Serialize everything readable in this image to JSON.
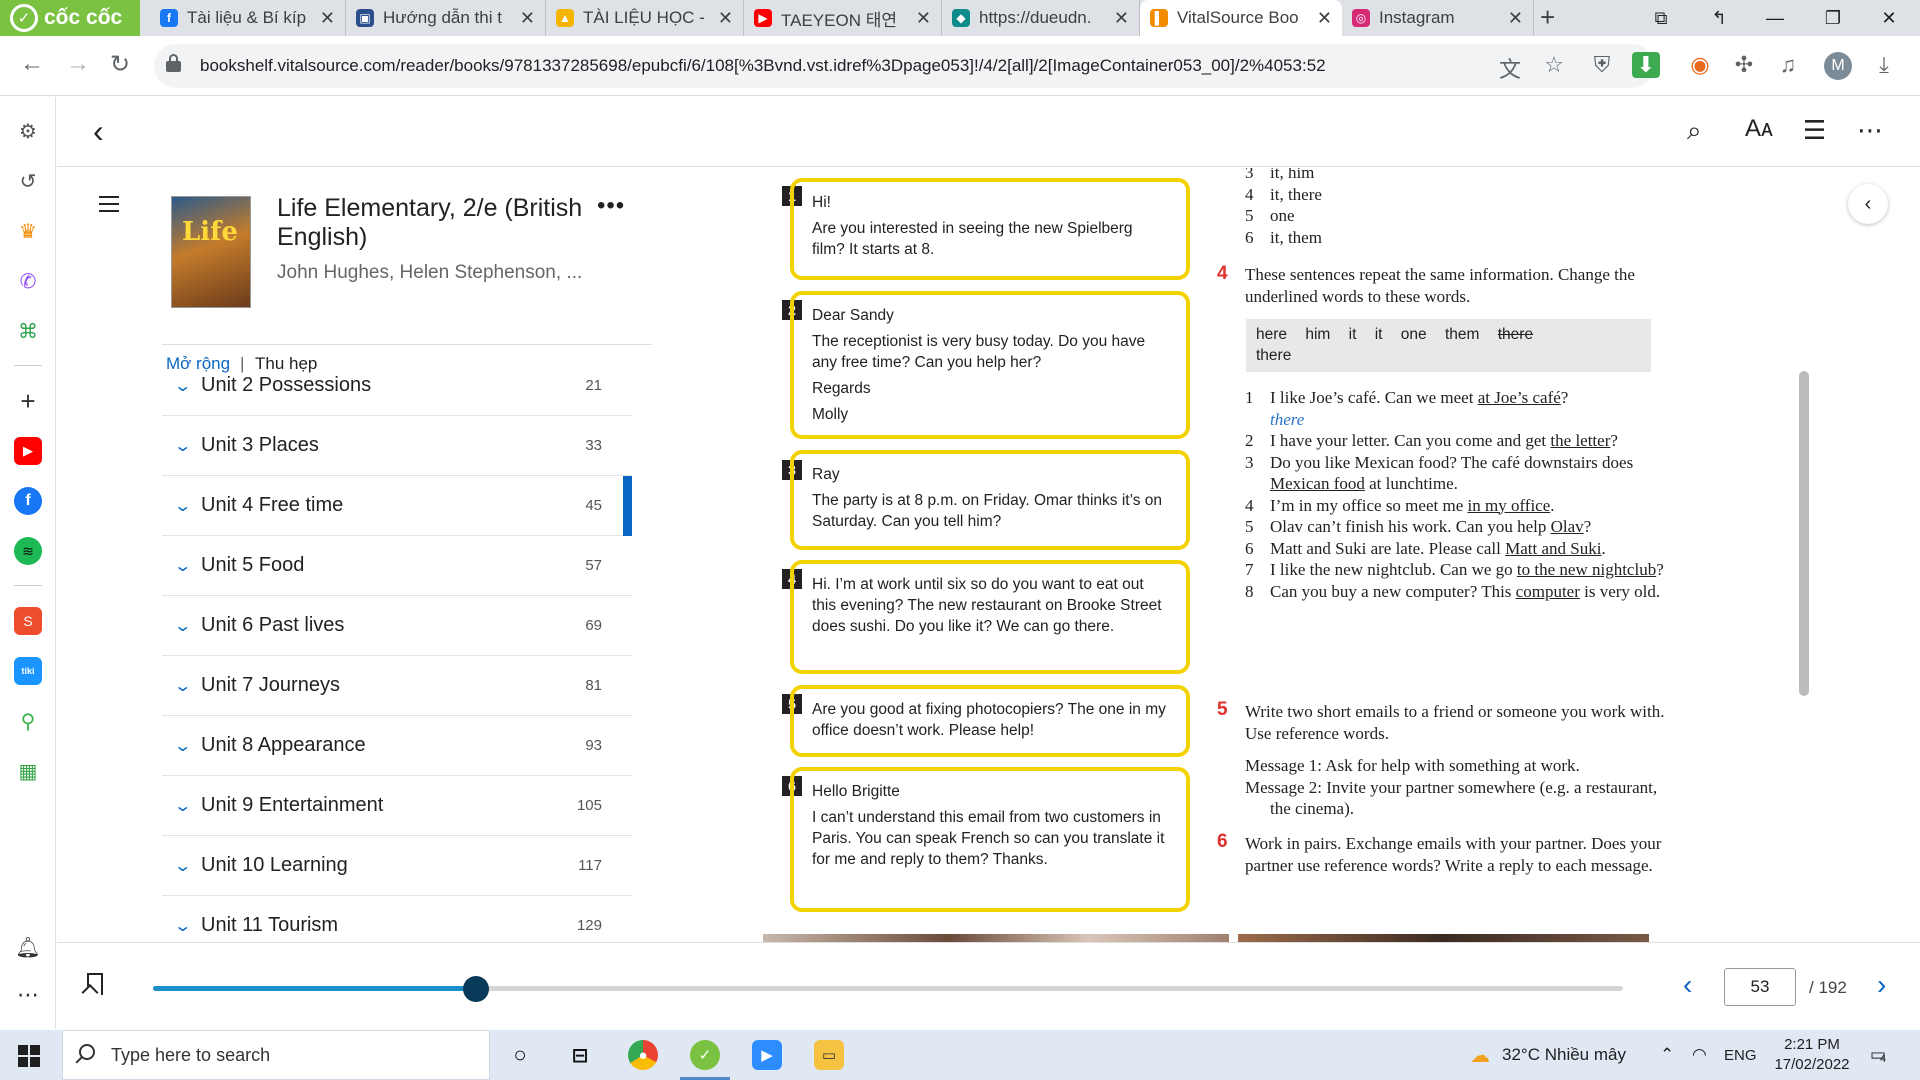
{
  "browser": {
    "brand": "cốc cốc",
    "tabs": [
      {
        "title": "Tài liệu & Bí kíp",
        "icon": "facebook-icon",
        "color": "#1877f2",
        "glyph": "f"
      },
      {
        "title": "Hướng dẫn thi t",
        "icon": "document-icon",
        "color": "#2b4f8c",
        "glyph": "▣"
      },
      {
        "title": "TÀI LIỆU HỌC -",
        "icon": "google-drive-icon",
        "color": "#f4b400",
        "glyph": "▲"
      },
      {
        "title": "TAEYEON 태연",
        "icon": "youtube-icon",
        "color": "#ff0000",
        "glyph": "▶"
      },
      {
        "title": "https://dueudn.",
        "icon": "chatbot-icon",
        "color": "#0e8c8c",
        "glyph": "◆"
      },
      {
        "title": "VitalSource Boo",
        "icon": "vitalsource-icon",
        "color": "#f28b00",
        "glyph": "▌"
      },
      {
        "title": "Instagram",
        "icon": "instagram-icon",
        "color": "#d62976",
        "glyph": "◎"
      }
    ],
    "active_tab": 5,
    "url": "bookshelf.vitalsource.com/reader/books/9781337285698/epubcfi/6/108[%3Bvnd.vst.idref%3Dpage053]!/4/2[all]/2[ImageContainer053_00]/2%4053:52",
    "profile_initial": "M"
  },
  "book": {
    "title": "Life Elementary, 2/e (British English)",
    "authors": "John Hughes, Helen Stephenson, ...",
    "cover_text": "Life"
  },
  "toc": {
    "expand_label": "Mở rộng",
    "separator": "|",
    "collapse_label": "Thu hẹp",
    "chevron": "⌄",
    "units": [
      {
        "label": "Unit 2 Possessions",
        "page": "21"
      },
      {
        "label": "Unit 3 Places",
        "page": "33"
      },
      {
        "label": "Unit 4 Free time",
        "page": "45"
      },
      {
        "label": "Unit 5 Food",
        "page": "57"
      },
      {
        "label": "Unit 6 Past lives",
        "page": "69"
      },
      {
        "label": "Unit 7 Journeys",
        "page": "81"
      },
      {
        "label": "Unit 8 Appearance",
        "page": "93"
      },
      {
        "label": "Unit 9 Entertainment",
        "page": "105"
      },
      {
        "label": "Unit 10 Learning",
        "page": "117"
      },
      {
        "label": "Unit 11 Tourism",
        "page": "129"
      }
    ],
    "current_unit_index": 2
  },
  "page": {
    "emails": [
      {
        "num": "1",
        "lines": [
          "Hi!",
          "Are you interested in seeing the new Spielberg film? It starts at 8."
        ]
      },
      {
        "num": "2",
        "lines": [
          "Dear Sandy",
          "The receptionist is very busy today. Do you have any free time? Can you help her?",
          "Regards",
          "Molly"
        ]
      },
      {
        "num": "3",
        "lines": [
          "Ray",
          "The party is at 8 p.m. on Friday. Omar thinks it’s on Saturday. Can you tell him?"
        ]
      },
      {
        "num": "4",
        "lines": [
          "Hi. I’m at work until six so do you want to eat out this evening? The new restaurant on Brooke Street does sushi. Do you like it? We can go there."
        ]
      },
      {
        "num": "5",
        "lines": [
          "Are you good at fixing photocopiers? The one in my office doesn’t work. Please help!"
        ]
      },
      {
        "num": "6",
        "lines": [
          "Hello Brigitte",
          "I can’t understand this email from two customers in Paris. You can speak French so can you translate it for me and reply to them? Thanks."
        ]
      }
    ],
    "prev_answers": [
      {
        "n": "3",
        "text": "it, him"
      },
      {
        "n": "4",
        "text": "it, there"
      },
      {
        "n": "5",
        "text": "one"
      },
      {
        "n": "6",
        "text": "it, them"
      }
    ],
    "ex4": {
      "num": "4",
      "instruction": "These sentences repeat the same information. Change the underlined words to these words.",
      "words": [
        "here",
        "him",
        "it",
        "it",
        "one",
        "them"
      ],
      "struck_word": "there",
      "last_word": "there",
      "example_answer": "there",
      "items": [
        {
          "n": "1",
          "before": "I like Joe’s café. Can we meet ",
          "u": "at Joe’s café",
          "after": "?"
        },
        {
          "n": "2",
          "before": "I have your letter. Can you come and get ",
          "u": "the letter",
          "after": "?"
        },
        {
          "n": "3",
          "before": "Do you like Mexican food? The café downstairs does ",
          "u": "Mexican food",
          "after": " at lunchtime."
        },
        {
          "n": "4",
          "before": "I’m in my office so meet me ",
          "u": "in my office",
          "after": "."
        },
        {
          "n": "5",
          "before": "Olav can’t finish his work. Can you help ",
          "u": "Olav",
          "after": "?"
        },
        {
          "n": "6",
          "before": "Matt and Suki are late. Please call ",
          "u": "Matt and Suki",
          "after": "."
        },
        {
          "n": "7",
          "before": "I like the new nightclub. Can we go ",
          "u": "to the new nightclub",
          "after": "?"
        },
        {
          "n": "8",
          "before": "Can you buy a new computer? This ",
          "u": "computer",
          "after": " is very old."
        }
      ]
    },
    "ex5": {
      "num": "5",
      "instruction": "Write two short emails to a friend or someone you work with. Use reference words.",
      "msg1": "Message 1: Ask for help with something at work.",
      "msg2": "Message 2: Invite your partner somewhere (e.g. a restaurant, the cinema)."
    },
    "ex6": {
      "num": "6",
      "instruction": "Work in pairs. Exchange emails with your partner. Does your partner use reference words? Write a reply to each message."
    }
  },
  "footer": {
    "current_page": "53",
    "total_pages": "/ 192",
    "progress_fraction": 0.22
  },
  "taskbar": {
    "search_placeholder": "Type here to search",
    "weather": "32°C  Nhiều mây",
    "lang": "ENG",
    "time": "2:21 PM",
    "date": "17/02/2022",
    "notif_count": "4"
  },
  "colors": {
    "accent": "#0a66c2",
    "email_border": "#f2d300",
    "exercise_number": "#e0312c",
    "progress": "#1a8fc9"
  }
}
